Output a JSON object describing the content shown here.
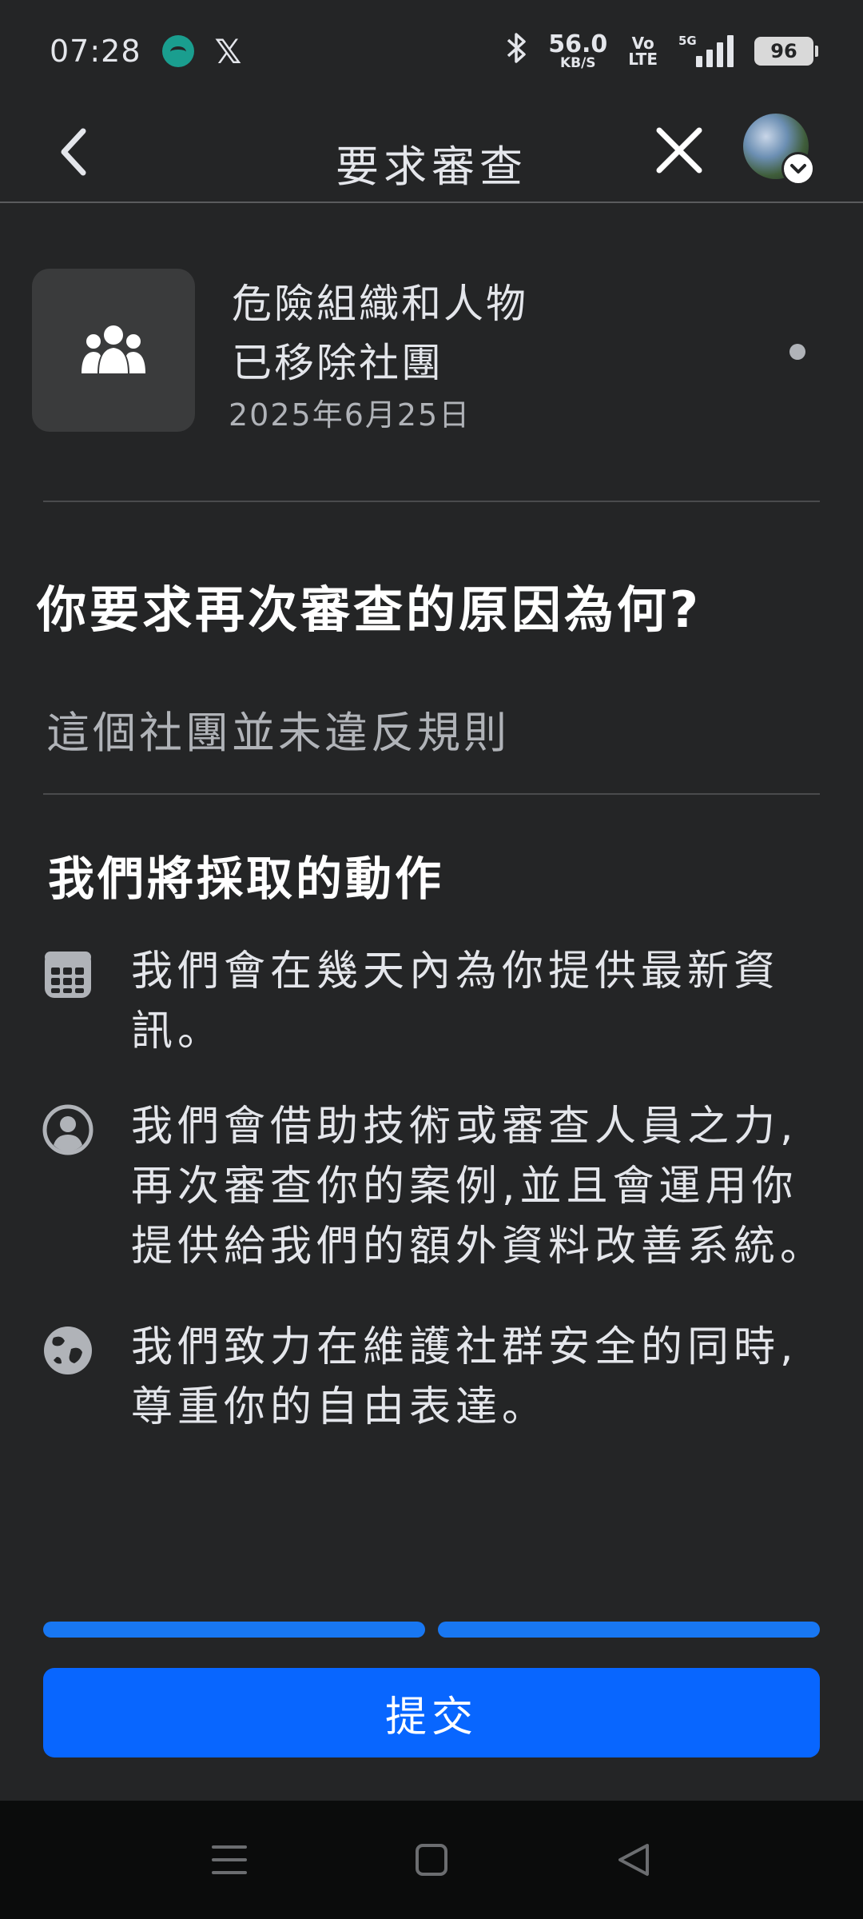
{
  "status_bar": {
    "time": "07:28",
    "network_speed": "56.0",
    "network_speed_unit": "KB/S",
    "volte_top": "Vo",
    "volte_bottom": "LTE",
    "network_type": "5G",
    "battery": "96"
  },
  "header": {
    "title": "要求審查"
  },
  "group": {
    "title": "危險組織和人物",
    "subtitle": "已移除社團",
    "date": "2025年6月25日"
  },
  "question": {
    "label": "你要求再次審查的原因為何?",
    "answer": "這個社團並未違反規則"
  },
  "actions": {
    "heading": "我們將採取的動作",
    "items": [
      {
        "icon": "calendar-icon",
        "text": "我們會在幾天內為你提供最新資訊。"
      },
      {
        "icon": "person-icon",
        "text": "我們會借助技術或審查人員之力,再次審查你的案例,並且會運用你提供給我們的額外資料改善系統。"
      },
      {
        "icon": "globe-icon",
        "text": "我們致力在維護社群安全的同時,尊重你的自由表達。"
      }
    ]
  },
  "progress": {
    "steps_completed": 2,
    "steps_total": 2
  },
  "submit": {
    "label": "提交"
  },
  "colors": {
    "background": "#242526",
    "accent": "#0866ff",
    "text": "#e4e6eb",
    "secondary_text": "#b0b3b8"
  }
}
